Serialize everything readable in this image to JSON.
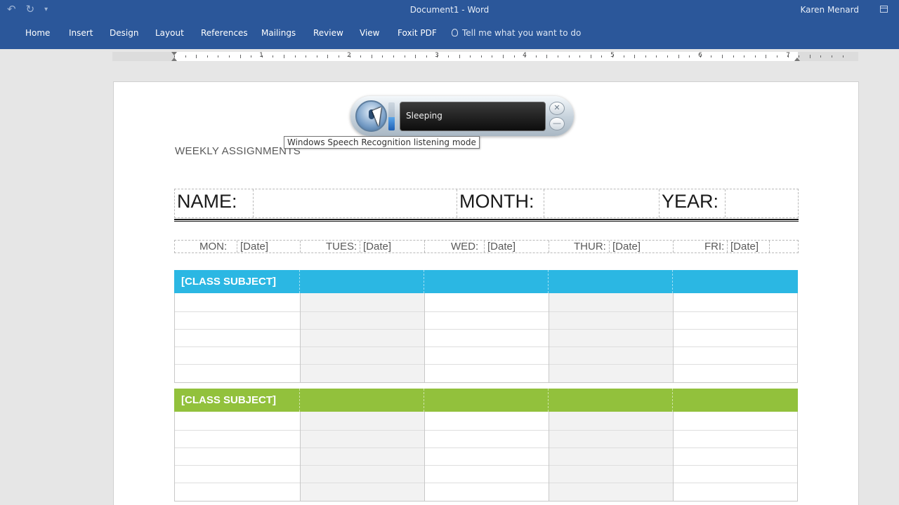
{
  "window": {
    "title": "Document1 - Word",
    "user": "Karen Menard"
  },
  "qat": {
    "undo_icon": "undo-icon",
    "redo_icon": "redo-icon",
    "customize_icon": "customize-qat-icon"
  },
  "ribbon": {
    "tabs": [
      "Home",
      "Insert",
      "Design",
      "Layout",
      "References",
      "Mailings",
      "Review",
      "View",
      "Foxit PDF"
    ],
    "tellme": "Tell me what you want to do"
  },
  "ruler": {
    "numbers": [
      "1",
      "2",
      "3",
      "4",
      "5",
      "6",
      "7"
    ]
  },
  "document": {
    "heading": "WEEKLY ASSIGNMENTS",
    "name_row": {
      "name": "NAME:",
      "month": "MONTH:",
      "year": "YEAR:"
    },
    "days": [
      {
        "day": "MON:",
        "date": "[Date]"
      },
      {
        "day": "TUES:",
        "date": "[Date]"
      },
      {
        "day": "WED:",
        "date": "[Date]"
      },
      {
        "day": "THUR:",
        "date": "[Date]"
      },
      {
        "day": "FRI:",
        "date": "[Date]"
      }
    ],
    "classes": [
      {
        "title": "[CLASS SUBJECT]",
        "color": "#2bb7e3"
      },
      {
        "title": "[CLASS SUBJECT]",
        "color": "#92c13c"
      }
    ]
  },
  "speech": {
    "status": "Sleeping",
    "tooltip": "Windows Speech Recognition listening mode",
    "close_glyph": "✕",
    "minimize_glyph": "—"
  }
}
